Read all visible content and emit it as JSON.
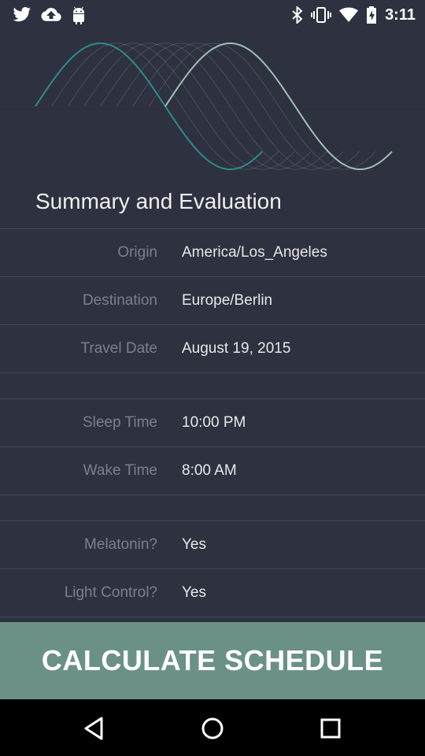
{
  "status_bar": {
    "time": "3:11",
    "left_icons": [
      "twitter-icon",
      "cloud-upload-icon",
      "android-icon"
    ],
    "right_icons": [
      "bluetooth-icon",
      "vibrate-icon",
      "wifi-icon",
      "battery-charging-icon"
    ]
  },
  "page": {
    "title": "Summary and Evaluation"
  },
  "summary": {
    "origin": {
      "label": "Origin",
      "value": "America/Los_Angeles"
    },
    "destination": {
      "label": "Destination",
      "value": "Europe/Berlin"
    },
    "travel_date": {
      "label": "Travel Date",
      "value": "August 19, 2015"
    },
    "sleep_time": {
      "label": "Sleep Time",
      "value": "10:00 PM"
    },
    "wake_time": {
      "label": "Wake Time",
      "value": "8:00 AM"
    },
    "melatonin": {
      "label": "Melatonin?",
      "value": "Yes"
    },
    "light_control": {
      "label": "Light Control?",
      "value": "Yes"
    }
  },
  "actions": {
    "calculate_label": "CALCULATE SCHEDULE"
  },
  "colors": {
    "background": "#2d3140",
    "button": "#6b9186",
    "wave_start": "#2e8b8b",
    "wave_end": "#9fc1b5"
  }
}
